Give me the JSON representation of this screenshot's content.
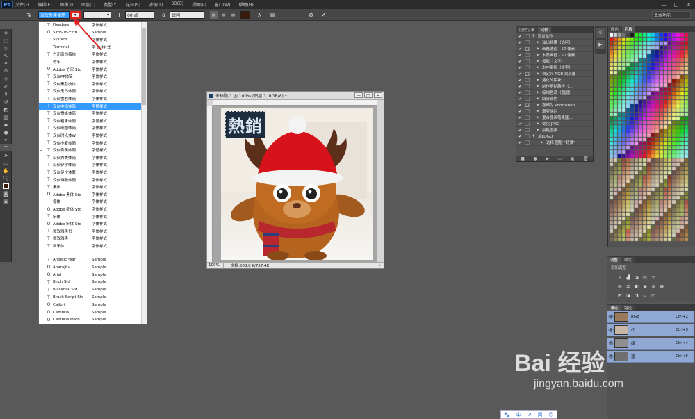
{
  "app": {
    "logo": "Ps",
    "menu": [
      "文件(F)",
      "编辑(E)",
      "图像(I)",
      "图层(L)",
      "类型(Y)",
      "选择(S)",
      "滤镜(T)",
      "3D(D)",
      "视图(V)",
      "窗口(W)",
      "帮助(H)"
    ],
    "window_controls": [
      "—",
      "□",
      "✕"
    ]
  },
  "options": {
    "font_family": "汉仪秀英体简",
    "font_size": "60 点",
    "antialias": "锐利",
    "workspace": "基本功能"
  },
  "font_list": {
    "items": [
      {
        "check": "",
        "icon": "T",
        "name": "Fixedsys",
        "sample": "字体样式"
      },
      {
        "check": "",
        "icon": "O",
        "name": "SimSun-ExtB",
        "sample": "Sample"
      },
      {
        "check": "",
        "icon": "",
        "name": "System",
        "sample": "字体样式"
      },
      {
        "check": "",
        "icon": "",
        "name": "Terminal",
        "sample": "字 体 样 式"
      },
      {
        "check": "",
        "icon": "T",
        "name": "方正康书楷体",
        "sample": "字体样式"
      },
      {
        "check": "",
        "icon": "",
        "name": "仿宋",
        "sample": "字体样式"
      },
      {
        "check": "",
        "icon": "O",
        "name": "Adobe 仿宋 Std",
        "sample": "字体样式"
      },
      {
        "check": "",
        "icon": "T",
        "name": "汉仪PP体简",
        "sample": "字体样式"
      },
      {
        "check": "",
        "icon": "T",
        "name": "汉仪黑荔枝体",
        "sample": "字体样式"
      },
      {
        "check": "",
        "icon": "T",
        "name": "汉仪鬼马体简",
        "sample": "字体样式"
      },
      {
        "check": "",
        "icon": "T",
        "name": "汉仪雪君体简",
        "sample": "字体样式"
      },
      {
        "check": "",
        "icon": "T",
        "name": "汉仪中楷体简",
        "sample": "字體樣式"
      },
      {
        "check": "",
        "icon": "T",
        "name": "汉仪雪峰体简",
        "sample": "字体样式"
      },
      {
        "check": "",
        "icon": "T",
        "name": "汉仪粗宋体简",
        "sample": "字體樣式"
      },
      {
        "check": "",
        "icon": "T",
        "name": "汉仪细圆体简",
        "sample": "字体样式"
      },
      {
        "check": "",
        "icon": "T",
        "name": "汉仪时光体W",
        "sample": "字体样式"
      },
      {
        "check": "",
        "icon": "T",
        "name": "汉仪小麦体简",
        "sample": "字体样式"
      },
      {
        "check": "✓",
        "icon": "T",
        "name": "汉仪秀英体简",
        "sample": "字體樣式"
      },
      {
        "check": "",
        "icon": "T",
        "name": "汉仪秀美体简",
        "sample": "字体样式"
      },
      {
        "check": "",
        "icon": "T",
        "name": "汉仪伊宁体简",
        "sample": "字体样式"
      },
      {
        "check": "",
        "icon": "T",
        "name": "汉仪伊宁体繁",
        "sample": "字体样式"
      },
      {
        "check": "",
        "icon": "T",
        "name": "汉仪诗酿体简",
        "sample": "字体样式"
      },
      {
        "check": "",
        "icon": "T",
        "name": "黑体",
        "sample": "字体样式"
      },
      {
        "check": "",
        "icon": "O",
        "name": "Adobe 黑体 Std",
        "sample": "字体样式"
      },
      {
        "check": "",
        "icon": "",
        "name": "楷体",
        "sample": "字体样式"
      },
      {
        "check": "",
        "icon": "O",
        "name": "Adobe 楷体 Std",
        "sample": "字体样式"
      },
      {
        "check": "",
        "icon": "T",
        "name": "宋体",
        "sample": "字体样式"
      },
      {
        "check": "",
        "icon": "O",
        "name": "Adobe 宋体 Std",
        "sample": "字体样式"
      },
      {
        "check": "",
        "icon": "T",
        "name": "微软雅黑书",
        "sample": "字体样式"
      },
      {
        "check": "",
        "icon": "T",
        "name": "微软雅黑",
        "sample": "字体样式"
      },
      {
        "check": "",
        "icon": "T",
        "name": "新宋体",
        "sample": "字体样式"
      },
      {
        "check": "",
        "icon": "T",
        "name": "Angelic War",
        "sample": "Sample"
      },
      {
        "check": "",
        "icon": "O",
        "name": "Aparajita",
        "sample": "Sample"
      },
      {
        "check": "",
        "icon": "O",
        "name": "Arial",
        "sample": "Sample"
      },
      {
        "check": "",
        "icon": "T",
        "name": "Birch Std",
        "sample": "Sample"
      },
      {
        "check": "",
        "icon": "T",
        "name": "Blackoak Std",
        "sample": "Sample"
      },
      {
        "check": "",
        "icon": "T",
        "name": "Brush Script Std",
        "sample": "Sample"
      },
      {
        "check": "",
        "icon": "O",
        "name": "Calibri",
        "sample": "Sample"
      },
      {
        "check": "",
        "icon": "O",
        "name": "Cambria",
        "sample": "Sample"
      },
      {
        "check": "",
        "icon": "O",
        "name": "Cambria Math",
        "sample": "Sample"
      }
    ]
  },
  "document": {
    "title": "未标题-1 @ 100% (图层 1, RGB/8) *",
    "zoom": "100%",
    "status": "文档:568.0 K/757.4K",
    "text": "熱銷",
    "buttons": [
      "—",
      "□",
      "✕"
    ]
  },
  "actions": {
    "tabs": [
      "历史记录",
      "动作"
    ],
    "items": [
      {
        "c2": "",
        "tri": "▼",
        "label": "默认动作"
      },
      {
        "c2": "",
        "tri": "▶",
        "label": "淡出效果（选区）"
      },
      {
        "c2": "□",
        "tri": "▶",
        "label": "画框通道 - 50 像素"
      },
      {
        "c2": "",
        "tri": "▶",
        "label": "木质画框 - 50 像素"
      },
      {
        "c2": "",
        "tri": "▶",
        "label": "投影（文字）"
      },
      {
        "c2": "",
        "tri": "▶",
        "label": "水中倒影（文字）"
      },
      {
        "c2": "□",
        "tri": "▶",
        "label": "自定义 RGB 到灰度"
      },
      {
        "c2": "",
        "tri": "▶",
        "label": "熔化的铅块"
      },
      {
        "c2": "",
        "tri": "▶",
        "label": "制作剪贴路径（..."
      },
      {
        "c2": "",
        "tri": "▶",
        "label": "棕褐色调（图层）"
      },
      {
        "c2": "",
        "tri": "▶",
        "label": "四分颜色"
      },
      {
        "c2": "□",
        "tri": "▶",
        "label": "存储为 Photoshop..."
      },
      {
        "c2": "",
        "tri": "▶",
        "label": "渐变映射"
      },
      {
        "c2": "",
        "tri": "▶",
        "label": "混合器画笔克隆..."
      },
      {
        "c2": "",
        "tri": "▶",
        "label": "优化 JPEG"
      },
      {
        "c2": "",
        "tri": "▶",
        "label": "拼贴图案"
      },
      {
        "c2": "",
        "tri": "▼",
        "label": "加LOGO"
      },
      {
        "c2": "",
        "tri": "▶",
        "label": "选择 图层 \"背景\""
      }
    ]
  },
  "swatches": {
    "tabs": [
      "颜色",
      "色板"
    ]
  },
  "adjust": {
    "tabs": [
      "调整",
      "样式"
    ],
    "label": "添加调整"
  },
  "channels": {
    "tabs": [
      "通道",
      "路径"
    ],
    "rows": [
      {
        "name": "RGB",
        "shortcut": "Ctrl+2"
      },
      {
        "name": "红",
        "shortcut": "Ctrl+3"
      },
      {
        "name": "绿",
        "shortcut": "Ctrl+4"
      },
      {
        "name": "蓝",
        "shortcut": "Ctrl+5"
      }
    ]
  },
  "baidu": {
    "items": [
      "🐾",
      "中",
      "↗",
      "简",
      "☺"
    ],
    "watermark": "Bai 经验",
    "watermark_url": "jingyan.baidu.com"
  }
}
